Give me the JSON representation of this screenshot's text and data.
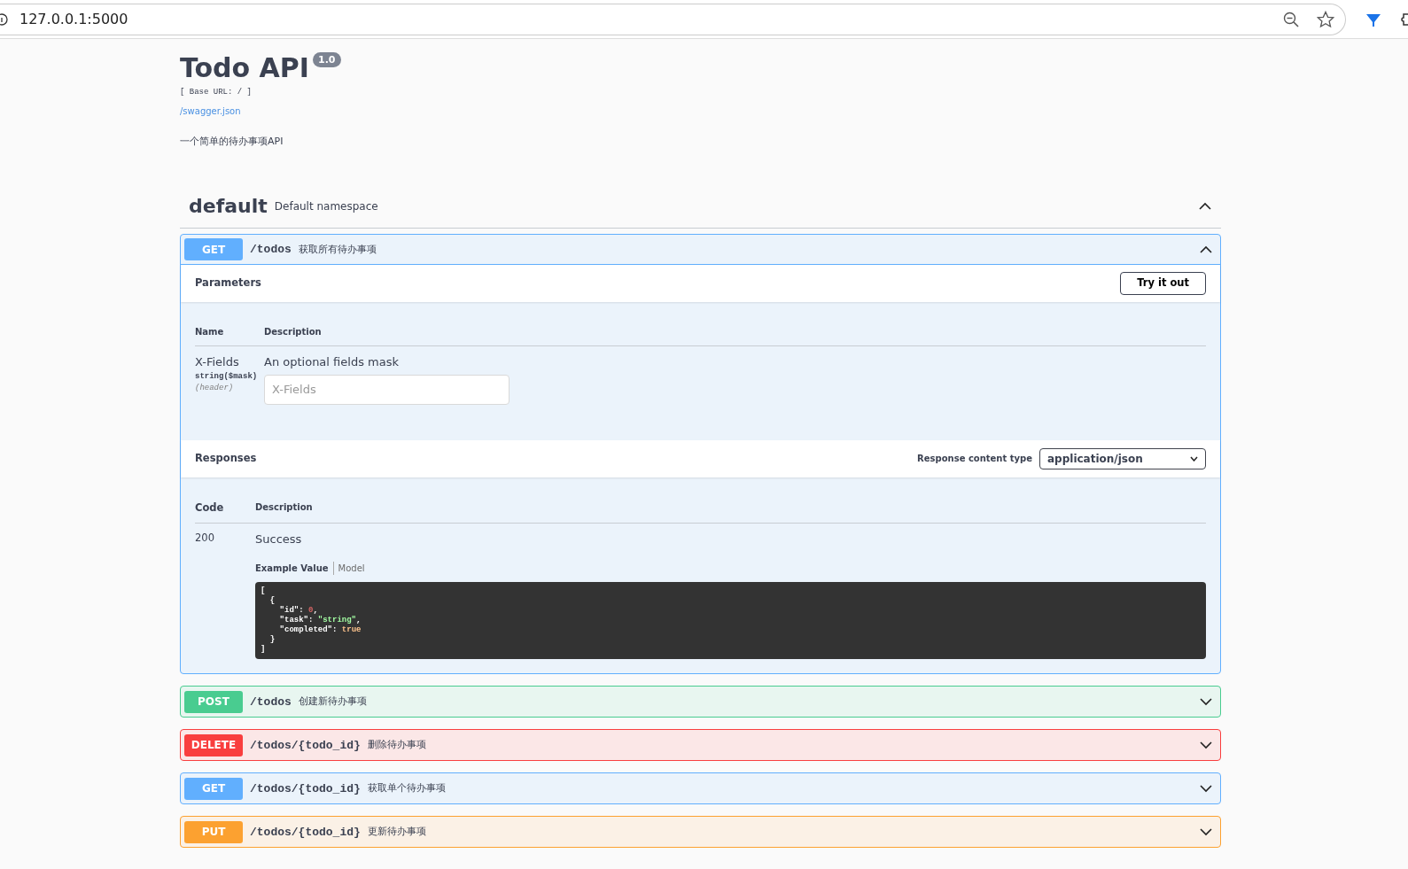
{
  "browser": {
    "url": "127.0.0.1:5000"
  },
  "info": {
    "title": "Todo API",
    "version": "1.0",
    "base_url": "[ Base URL: / ]",
    "spec_link": "/swagger.json",
    "description": "一个简单的待办事项API"
  },
  "namespace": {
    "name": "default",
    "description": "Default namespace",
    "expanded": true
  },
  "operations": [
    {
      "method": "GET",
      "path": "/todos",
      "summary": "获取所有待办事项",
      "expanded": true,
      "details": {
        "parameters_title": "Parameters",
        "try_button": "Try it out",
        "param_columns": [
          "Name",
          "Description"
        ],
        "parameters": [
          {
            "name": "X-Fields",
            "type": "string($mask)",
            "location": "(header)",
            "description": "An optional fields mask",
            "placeholder": "X-Fields"
          }
        ],
        "responses_title": "Responses",
        "content_type_label": "Response content type",
        "content_type": "application/json",
        "response_columns": [
          "Code",
          "Description"
        ],
        "responses": [
          {
            "code": "200",
            "description": "Success",
            "tabs": [
              {
                "label": "Example Value",
                "selected": true
              },
              {
                "label": "Model",
                "selected": false
              }
            ],
            "example_lines": [
              [
                {
                  "kind": "punct",
                  "text": "["
                }
              ],
              [
                {
                  "kind": "punct",
                  "text": "  {"
                }
              ],
              [
                {
                  "kind": "key",
                  "text": "    \"id\": "
                },
                {
                  "kind": "number",
                  "text": "0"
                },
                {
                  "kind": "punct",
                  "text": ","
                }
              ],
              [
                {
                  "kind": "key",
                  "text": "    \"task\": "
                },
                {
                  "kind": "string",
                  "text": "\"string\""
                },
                {
                  "kind": "punct",
                  "text": ","
                }
              ],
              [
                {
                  "kind": "key",
                  "text": "    \"completed\": "
                },
                {
                  "kind": "boolean",
                  "text": "true"
                }
              ],
              [
                {
                  "kind": "punct",
                  "text": "  }"
                }
              ],
              [
                {
                  "kind": "punct",
                  "text": "]"
                }
              ]
            ]
          }
        ]
      }
    },
    {
      "method": "POST",
      "path": "/todos",
      "summary": "创建新待办事项",
      "expanded": false
    },
    {
      "method": "DELETE",
      "path": "/todos/{todo_id}",
      "summary": "删除待办事项",
      "expanded": false
    },
    {
      "method": "GET",
      "path": "/todos/{todo_id}",
      "summary": "获取单个待办事项",
      "expanded": false
    },
    {
      "method": "PUT",
      "path": "/todos/{todo_id}",
      "summary": "更新待办事项",
      "expanded": false
    }
  ]
}
